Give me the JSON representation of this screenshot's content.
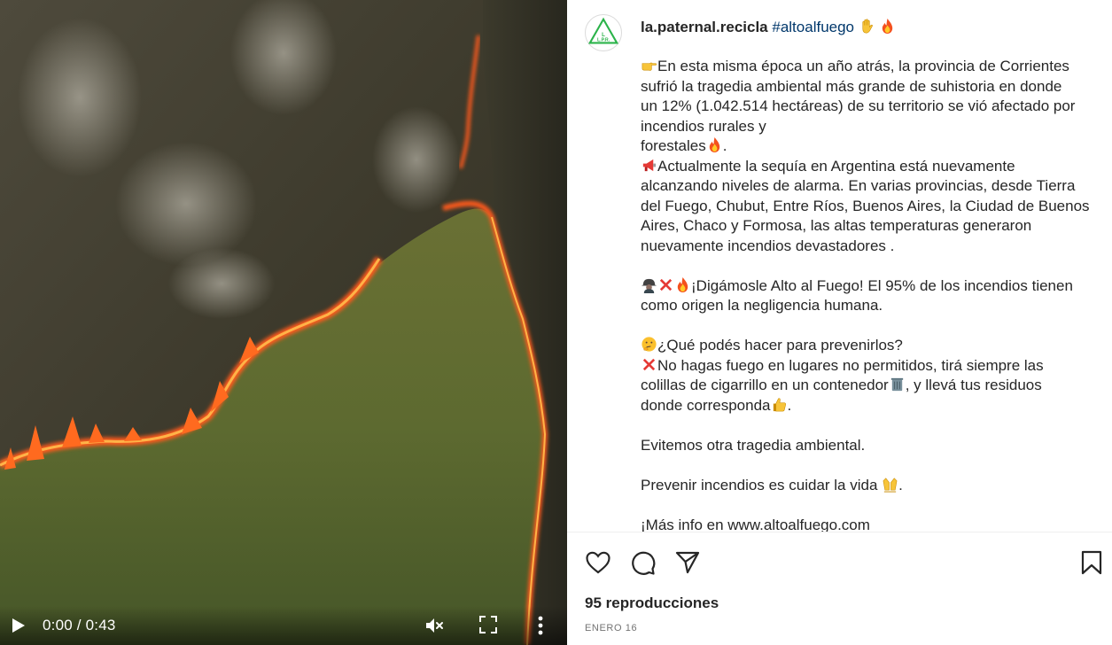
{
  "video": {
    "time_current": "0:00",
    "time_total": "0:43",
    "time_display": "0:00 / 0:43",
    "icons": {
      "play": "play-icon",
      "mute": "speaker-muted-icon",
      "fullscreen": "fullscreen-icon",
      "more": "vertical-dots-icon"
    }
  },
  "post": {
    "avatar_text": "L.P.R.",
    "username": "la.paternal.recicla",
    "hashtag": "#altoalfuego",
    "caption_lines": [
      {
        "emoji": "pointing-hand-icon",
        "text": "En esta misma época un año atrás, la provincia de Corrientes"
      },
      {
        "emoji": "",
        "text": "sufrió la tragedia ambiental más grande de suhistoria en donde"
      },
      {
        "emoji": "",
        "text": "un 12% (1.042.514 hectáreas) de su territorio se vió afectado por"
      },
      {
        "emoji": "",
        "text": "incendios rurales y"
      },
      {
        "emoji": "",
        "text": "forestales",
        "emoji_after": "fire-icon",
        "tail": "."
      },
      {
        "emoji": "megaphone-icon",
        "text": "Actualmente la sequía en Argentina está nuevamente"
      },
      {
        "emoji": "",
        "text": "alcanzando niveles de alarma. En varias provincias, desde Tierra"
      },
      {
        "emoji": "",
        "text": "del Fuego, Chubut, Entre Ríos, Buenos Aires, la Ciudad de Buenos"
      },
      {
        "emoji": "",
        "text": "Aires, Chaco y Formosa, las altas temperaturas generaron"
      },
      {
        "emoji": "",
        "text": "nuevamente incendios devastadores ."
      },
      {
        "gap": true
      },
      {
        "emoji": "firefighter-icon",
        "emoji2": "cross-mark-icon",
        "emoji3": "fire-icon",
        "text": "¡Digámosle Alto al Fuego! El 95% de los incendios tienen"
      },
      {
        "emoji": "",
        "text": "como origen la negligencia humana."
      },
      {
        "gap": true
      },
      {
        "emoji": "thinking-face-icon",
        "text": "¿Qué podés hacer para prevenirlos?"
      },
      {
        "emoji": "cross-mark-icon",
        "text": "No hagas fuego en lugares no permitidos, tirá siempre las"
      },
      {
        "emoji": "",
        "text": "colillas de cigarrillo en un contenedor",
        "emoji_after": "trash-can-icon",
        "tail": ", y llevá tus residuos"
      },
      {
        "emoji": "",
        "text": "donde corresponda",
        "emoji_after": "thumbs-up-icon",
        "tail": "."
      },
      {
        "gap": true
      },
      {
        "emoji": "",
        "text": "Evitemos otra tragedia ambiental."
      },
      {
        "gap": true
      },
      {
        "emoji": "",
        "text": "Prevenir incendios es cuidar la vida ",
        "emoji_after": "raising-hands-icon",
        "tail": "."
      },
      {
        "gap": true
      },
      {
        "emoji": "",
        "text": "¡Más info en www.altoalfuego.com"
      }
    ],
    "header_emojis": [
      "raised-hand-icon",
      "fire-icon"
    ]
  },
  "actions": {
    "like": "heart-icon",
    "comment": "comment-bubble-icon",
    "share": "paper-plane-icon",
    "save": "bookmark-icon"
  },
  "stats": {
    "views": "95 reproducciones",
    "date": "ENERO 16"
  },
  "colors": {
    "link": "#00376b",
    "text": "#262626",
    "muted": "#737373",
    "fire": "#ff5a1a",
    "grass": "#5e6b2e"
  }
}
